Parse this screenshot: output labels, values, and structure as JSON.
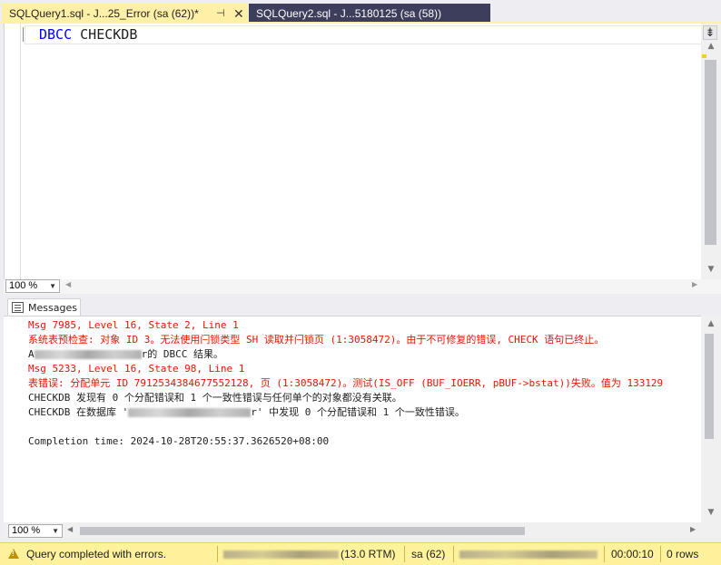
{
  "tabs": [
    {
      "label": "SQLQuery1.sql - J...25_Error (sa (62))*",
      "pin": "⊣",
      "close": "✕"
    },
    {
      "label": "SQLQuery2.sql - J...5180125 (sa (58))"
    }
  ],
  "editor": {
    "keyword": "DBCC",
    "identifier": "CHECKDB"
  },
  "zoom": {
    "editor": "100 %",
    "results": "100 %"
  },
  "results": {
    "tab_label": "Messages",
    "lines": [
      {
        "text": "Msg 7985, Level 16, State 2, Line 1",
        "color": "red"
      },
      {
        "text": "系统表预检查: 对象 ID 3。无法使用闩锁类型 SH 读取并闩锁页 (1:3058472)。由于不可修复的错误, CHECK 语句已终止。",
        "color": "red"
      },
      {
        "prefix": "A",
        "suffix": "r的 DBCC 结果。",
        "color": "black"
      },
      {
        "text": "Msg 5233, Level 16, State 98, Line 1",
        "color": "red"
      },
      {
        "text": "表错误: 分配单元 ID 7912534384677552128, 页 (1:3058472)。测试(IS_OFF (BUF_IOERR, pBUF->bstat))失败。值为 133129",
        "color": "red"
      },
      {
        "text": "CHECKDB 发现有 0 个分配错误和 1 个一致性错误与任何单个的对象都没有关联。",
        "color": "black"
      },
      {
        "prefix": "CHECKDB 在数据库 '",
        "suffix": "r' 中发现 0 个分配错误和 1 个一致性错误。",
        "color": "black"
      },
      {
        "text": "",
        "color": "black"
      },
      {
        "text": "Completion time: 2024-10-28T20:55:37.3626520+08:00",
        "color": "black"
      }
    ]
  },
  "status": {
    "message": "Query completed with errors.",
    "server_version": "(13.0 RTM)",
    "user": "sa (62)",
    "elapsed": "00:00:10",
    "rows": "0 rows"
  },
  "colors": {
    "status_bg": "#fff29d",
    "active_tab": "#fff0a8",
    "inactive_tab": "#3d3d5c",
    "error_text": "#e51400",
    "keyword": "#0000ff"
  }
}
